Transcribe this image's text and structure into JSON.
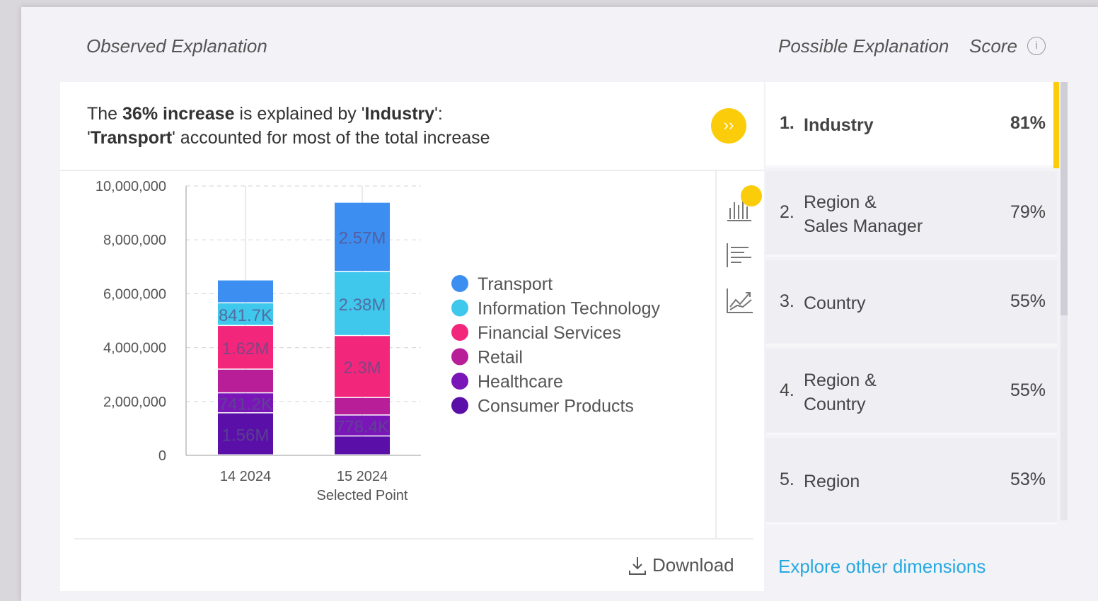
{
  "header": {
    "observed": "Observed Explanation",
    "possible": "Possible Explanation",
    "score": "Score",
    "info_glyph": "i"
  },
  "summary": {
    "p1": "The ",
    "b1": "36% increase",
    "p2": " is explained by '",
    "b2": "Industry",
    "p3": "':",
    "b3": "Transport",
    "p4": "' accounted for most of the total increase",
    "q": "'"
  },
  "go_glyph": "››",
  "download_label": "Download",
  "explore_label": "Explore other dimensions",
  "explanations": [
    {
      "num": "1.",
      "label": "Industry",
      "pct": "81%",
      "active": true
    },
    {
      "num": "2.",
      "label": "Region &\nSales Manager",
      "pct": "79%"
    },
    {
      "num": "3.",
      "label": "Country",
      "pct": "55%"
    },
    {
      "num": "4.",
      "label": "Region &\nCountry",
      "pct": "55%"
    },
    {
      "num": "5.",
      "label": "Region",
      "pct": "53%"
    }
  ],
  "colors": {
    "accent": "#fbcc0a",
    "link": "#25a9e0"
  },
  "chart_data": {
    "type": "bar",
    "stacked": true,
    "categories": [
      "14 2024",
      "15 2024"
    ],
    "category_sublabels": [
      "",
      "Selected Point"
    ],
    "ylim": [
      0,
      10000000
    ],
    "yticks": [
      0,
      2000000,
      4000000,
      6000000,
      8000000,
      10000000
    ],
    "ytick_labels": [
      "0",
      "2,000,000",
      "4,000,000",
      "6,000,000",
      "8,000,000",
      "10,000,000"
    ],
    "series": [
      {
        "name": "Consumer Products",
        "color": "#5a10a8",
        "values": [
          1560000,
          700000
        ],
        "labels": [
          "1.56M",
          ""
        ]
      },
      {
        "name": "Healthcare",
        "color": "#7a16b8",
        "values": [
          741200,
          778400
        ],
        "labels": [
          "741.2K",
          "778.4K"
        ]
      },
      {
        "name": "Retail",
        "color": "#b81e98",
        "values": [
          880000,
          650000
        ],
        "labels": [
          "",
          ""
        ]
      },
      {
        "name": "Financial Services",
        "color": "#f2277b",
        "values": [
          1620000,
          2300000
        ],
        "labels": [
          "1.62M",
          "2.3M"
        ]
      },
      {
        "name": "Information Technology",
        "color": "#3fc8ec",
        "values": [
          841700,
          2380000
        ],
        "labels": [
          "841.7K",
          "2.38M"
        ]
      },
      {
        "name": "Transport",
        "color": "#3c8ff0",
        "values": [
          850000,
          2570000
        ],
        "labels": [
          "",
          "2.57M"
        ]
      }
    ],
    "legend": [
      "Transport",
      "Information Technology",
      "Financial Services",
      "Retail",
      "Healthcare",
      "Consumer Products"
    ],
    "legend_colors": [
      "#3c8ff0",
      "#3fc8ec",
      "#f2277b",
      "#b81e98",
      "#7a16b8",
      "#5a10a8"
    ],
    "grid": true,
    "legend_position": "right"
  }
}
